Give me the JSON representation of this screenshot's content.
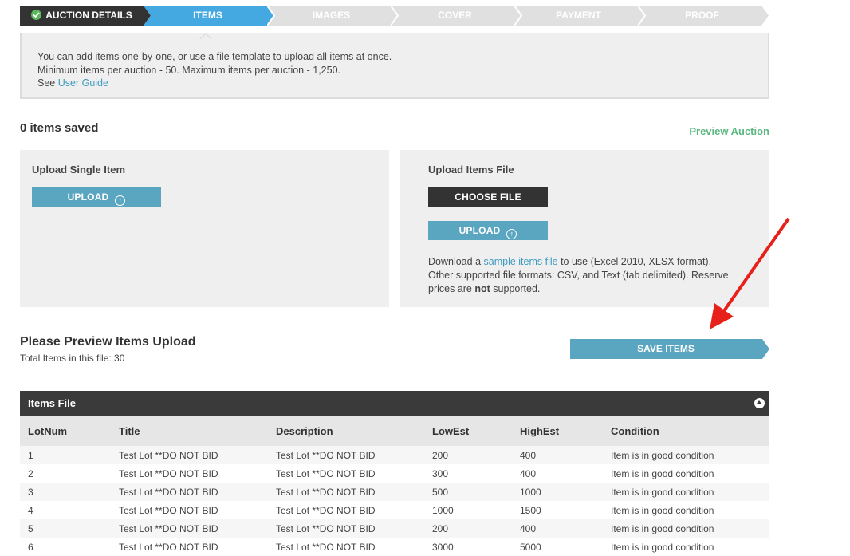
{
  "steps": [
    {
      "label": "AUCTION DETAILS",
      "state": "done"
    },
    {
      "label": "ITEMS",
      "state": "active"
    },
    {
      "label": "IMAGES",
      "state": "pending"
    },
    {
      "label": "COVER",
      "state": "pending"
    },
    {
      "label": "PAYMENT",
      "state": "pending"
    },
    {
      "label": "PROOF",
      "state": "pending"
    }
  ],
  "info": {
    "line1": "You can add items one-by-one, or use a file template to upload all items at once.",
    "line2": "Minimum items per auction - 50. Maximum items per auction - 1,250.",
    "see": "See",
    "guide_link": "User Guide"
  },
  "saved_count": "0 items saved",
  "preview_link": "Preview Auction",
  "single": {
    "title": "Upload Single Item",
    "upload_label": "UPLOAD"
  },
  "file": {
    "title": "Upload Items File",
    "choose_label": "CHOOSE FILE",
    "upload_label": "UPLOAD",
    "dl_prefix": "Download a",
    "dl_link": "sample items file",
    "dl_suffix": "to use (Excel 2010, XLSX format).",
    "formats": "Other supported file formats: CSV, and Text (tab delimited). Reserve prices are",
    "not": "not",
    "supported": "supported."
  },
  "preview": {
    "title": "Please Preview Items Upload",
    "total": "Total Items in this file: 30",
    "save_label": "SAVE ITEMS"
  },
  "table": {
    "title": "Items File",
    "columns": [
      "LotNum",
      "Title",
      "Description",
      "LowEst",
      "HighEst",
      "Condition"
    ],
    "rows": [
      [
        "1",
        "Test Lot **DO NOT BID",
        "Test Lot **DO NOT BID",
        "200",
        "400",
        "Item is in good condition"
      ],
      [
        "2",
        "Test Lot **DO NOT BID",
        "Test Lot **DO NOT BID",
        "300",
        "400",
        "Item is in good condition"
      ],
      [
        "3",
        "Test Lot **DO NOT BID",
        "Test Lot **DO NOT BID",
        "500",
        "1000",
        "Item is in good condition"
      ],
      [
        "4",
        "Test Lot **DO NOT BID",
        "Test Lot **DO NOT BID",
        "1000",
        "1500",
        "Item is in good condition"
      ],
      [
        "5",
        "Test Lot **DO NOT BID",
        "Test Lot **DO NOT BID",
        "200",
        "400",
        "Item is in good condition"
      ],
      [
        "6",
        "Test Lot **DO NOT BID",
        "Test Lot **DO NOT BID",
        "3000",
        "5000",
        "Item is in good condition"
      ]
    ]
  },
  "colors": {
    "active": "#44a9e0",
    "done": "#333333",
    "pending": "#e0e0e0",
    "accent_blue": "#5aa5c0",
    "preview_green": "#5cb881",
    "arrow_red": "#e8201a"
  }
}
